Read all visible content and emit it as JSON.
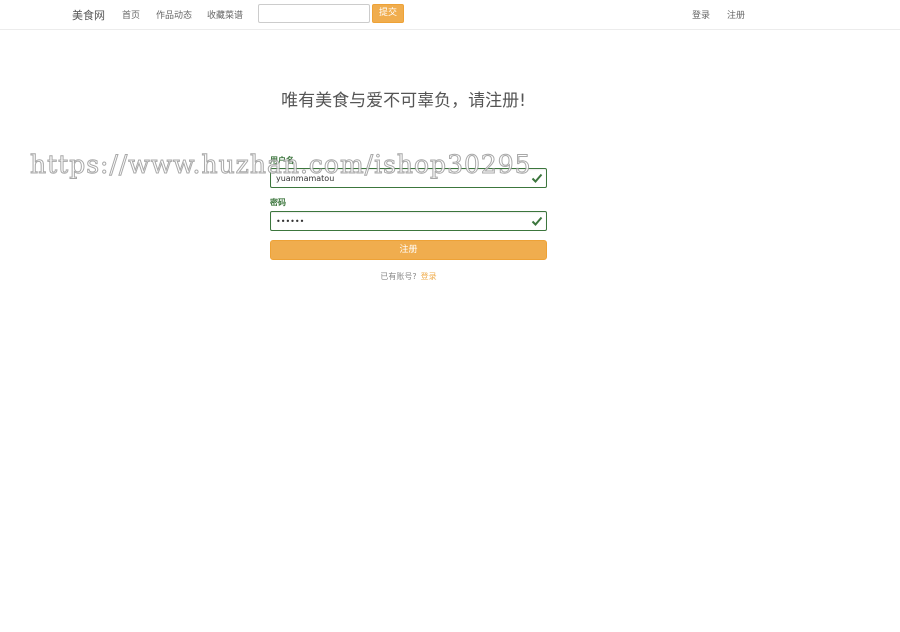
{
  "navbar": {
    "brand": "美食网",
    "links": [
      {
        "label": "首页"
      },
      {
        "label": "作品动态"
      },
      {
        "label": "收藏菜谱"
      }
    ],
    "search": {
      "value": "",
      "placeholder": ""
    },
    "submit_label": "提交",
    "login_label": "登录",
    "register_label": "注册"
  },
  "main": {
    "title": "唯有美食与爱不可辜负，请注册!",
    "username": {
      "label": "用户名",
      "value": "yuanmamatou"
    },
    "password": {
      "label": "密码",
      "value": "••••••"
    },
    "register_button": "注册",
    "have_account_text": "已有账号?",
    "login_link": "登录"
  },
  "colors": {
    "accent": "#f0ad4e",
    "success": "#3c763d"
  },
  "watermark": "https://www.huzhan.com/ishop30295"
}
